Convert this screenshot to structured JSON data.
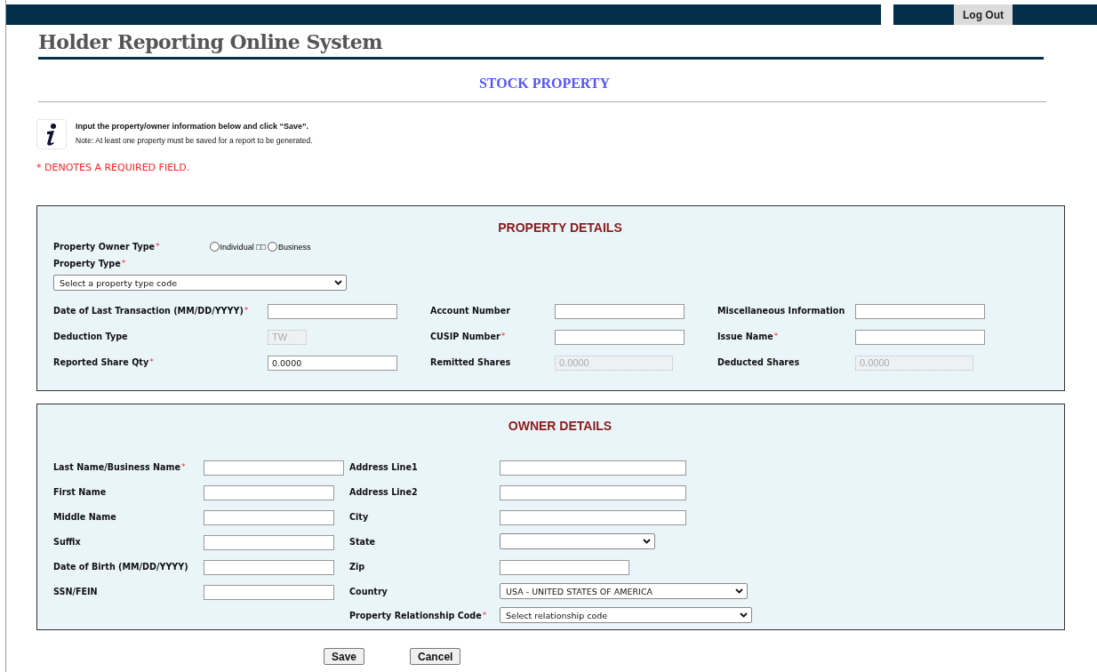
{
  "top_bar": {
    "logout_button": "Log Out"
  },
  "site_title": "Holder Reporting Online System",
  "page_heading": "STOCK PROPERTY",
  "info": {
    "instruction": "Input the property/owner information below and click “Save”.",
    "note": "Note: At least one property must be saved for a report to be generated."
  },
  "required_legend": "* DENOTES A REQUIRED FIELD.",
  "property_details": {
    "heading": "PROPERTY DETAILS",
    "owner_type": {
      "label": "Property Owner Type",
      "marker": "*",
      "options": [
        {
          "label": "Individual □□",
          "selected": false
        },
        {
          "label": "Business",
          "selected": false
        }
      ]
    },
    "property_type": {
      "label": "Property Type",
      "marker": "*",
      "value": "Select a property type code"
    },
    "fields": [
      {
        "label": "Date of Last Transaction (MM/DD/YYYY)",
        "marker": "*",
        "kind": "text"
      },
      {
        "label": "Account Number",
        "kind": "text"
      },
      {
        "label": "Miscellaneous Information",
        "kind": "text"
      },
      {
        "label": "Deduction Type",
        "kind": "text",
        "value": "TW",
        "disabled": true
      },
      {
        "label": "CUSIP Number",
        "marker": "*",
        "kind": "text"
      },
      {
        "label": "Issue Name",
        "marker": "*",
        "kind": "text"
      },
      {
        "label": "Reported Share Qty",
        "marker": "*",
        "kind": "text",
        "value": "0.0000"
      },
      {
        "label": "Remitted Shares",
        "kind": "text",
        "value": "0.0000",
        "disabled": true
      },
      {
        "label": "Deducted Shares",
        "kind": "text",
        "value": "0.0000",
        "disabled": true
      }
    ]
  },
  "owner_details": {
    "heading": "OWNER DETAILS",
    "left_fields": [
      {
        "label": "Last Name/Business Name",
        "marker": "*",
        "kind": "text"
      },
      {
        "label": "First Name",
        "kind": "text"
      },
      {
        "label": "Middle Name",
        "kind": "text"
      },
      {
        "label": "Suffix",
        "kind": "text"
      },
      {
        "label": "Date of Birth (MM/DD/YYYY)",
        "kind": "text"
      },
      {
        "label": "SSN/FEIN",
        "kind": "text"
      }
    ],
    "right_fields": [
      {
        "label": "Address Line1",
        "kind": "text"
      },
      {
        "label": "Address Line2",
        "kind": "text"
      },
      {
        "label": "City",
        "kind": "text"
      },
      {
        "label": "State",
        "kind": "select"
      },
      {
        "label": "Zip",
        "kind": "text"
      },
      {
        "label": "Country",
        "kind": "select",
        "value": "USA - UNITED STATES OF AMERICA"
      },
      {
        "label": "Property Relationship Code",
        "marker": "*",
        "kind": "select",
        "value": "Select relationship code"
      }
    ]
  },
  "buttons": [
    "Save",
    "Cancel"
  ]
}
